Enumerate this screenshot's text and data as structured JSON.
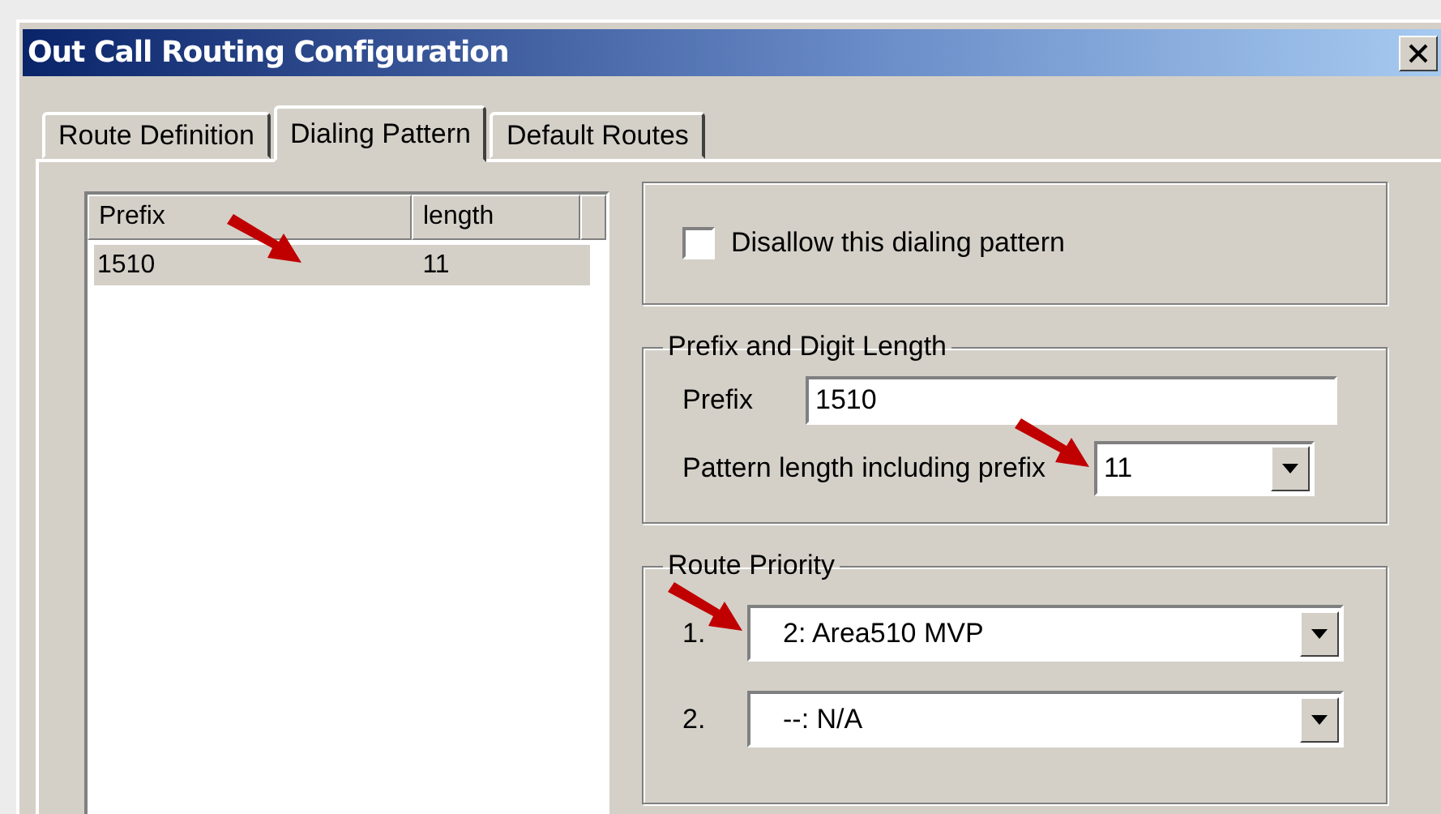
{
  "window": {
    "title": "Out Call Routing Configuration"
  },
  "tabs": [
    {
      "label": "Route Definition",
      "selected": false
    },
    {
      "label": "Dialing Pattern",
      "selected": true
    },
    {
      "label": "Default Routes",
      "selected": false
    }
  ],
  "pattern_list": {
    "columns": [
      "Prefix",
      "length"
    ],
    "rows": [
      {
        "prefix": "1510",
        "length": "11",
        "selected": true
      }
    ]
  },
  "disallow": {
    "label": "Disallow this dialing pattern",
    "checked": false
  },
  "prefix_group": {
    "title": "Prefix and Digit Length",
    "prefix_label": "Prefix",
    "prefix_value": "1510",
    "length_label": "Pattern length including prefix",
    "length_value": "11"
  },
  "route_priority": {
    "title": "Route Priority",
    "routes": [
      {
        "number": "1.",
        "value": "2: Area510 MVP"
      },
      {
        "number": "2.",
        "value": "--: N/A"
      }
    ]
  }
}
